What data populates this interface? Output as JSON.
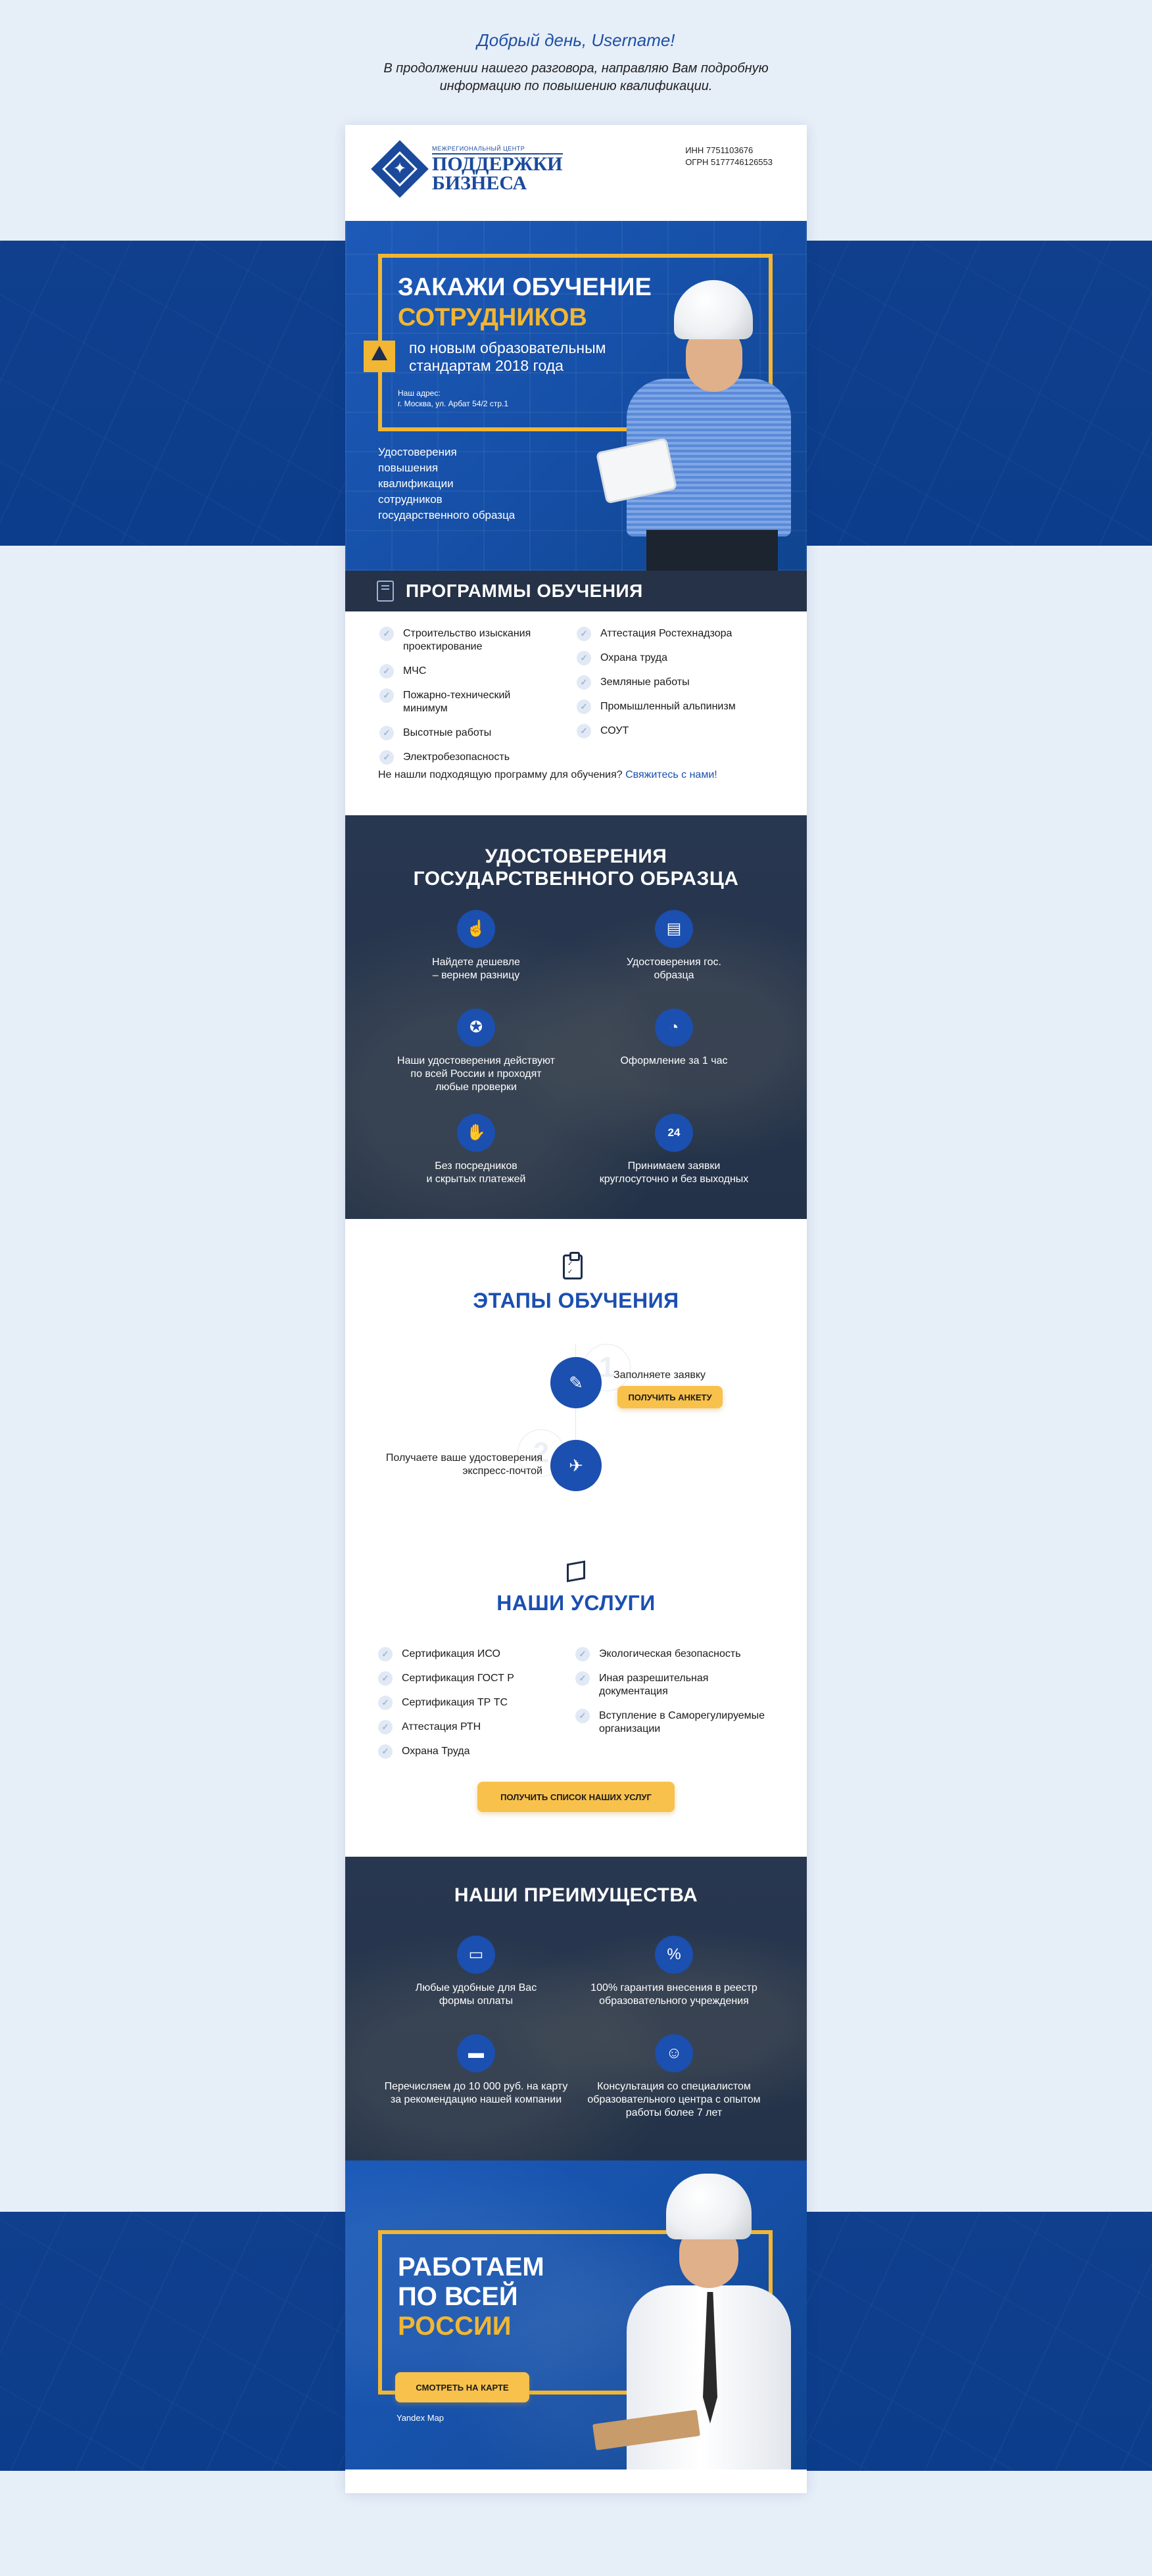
{
  "greeting": {
    "title": "Добрый день, Username!",
    "line1": "В продолжении нашего разговора, направляю Вам подробную",
    "line2": "информацию по повышению квалификации."
  },
  "header": {
    "logo_small": "МЕЖРЕГИОНАЛЬНЫЙ ЦЕНТР",
    "logo_line1": "ПОДДЕРЖКИ",
    "logo_line2": "БИЗНЕСА",
    "inn": "ИНН 7751103676",
    "ogrn": "ОГРН 5177746126553"
  },
  "hero": {
    "title_line1": "ЗАКАЖИ ОБУЧЕНИЕ",
    "title_line2": "СОТРУДНИКОВ",
    "sub_line1": "по новым образовательным",
    "sub_line2": "стандартам 2018 года",
    "addr_label": "Наш адрес:",
    "addr_value": "г. Москва, ул. Арбат 54/2 стр.1",
    "list": [
      "Удостоверения",
      "повышения",
      "квалификации",
      "сотрудников",
      "государственного образца"
    ]
  },
  "programs": {
    "title": "ПРОГРАММЫ ОБУЧЕНИЯ",
    "left": [
      "Строительство изыскания проектирование",
      "МЧС",
      "Пожарно-технический минимум",
      "Высотные работы",
      "Электробезопасность"
    ],
    "right": [
      "Аттестация Ростехнадзора",
      "Охрана труда",
      "Земляные работы",
      "Промышленный альпинизм",
      "СОУТ"
    ],
    "note": "Не нашли подходящую программу для обучения?",
    "note_link": "Свяжитесь с нами!"
  },
  "certificates": {
    "title_line1": "УДОСТОВЕРЕНИЯ",
    "title_line2": "ГОСУДАРСТВЕННОГО ОБРАЗЦА",
    "items": [
      {
        "l1": "Найдете дешевле",
        "l2": "– вернем разницу",
        "l3": ""
      },
      {
        "l1": "Удостоверения гос.",
        "l2": "образца",
        "l3": ""
      },
      {
        "l1": "Наши удостоверения действуют",
        "l2": "по всей России и проходят",
        "l3": "любые проверки"
      },
      {
        "l1": "Оформление за 1 час",
        "l2": "",
        "l3": ""
      },
      {
        "l1": "Без посредников",
        "l2": "и скрытых платежей",
        "l3": ""
      },
      {
        "l1": "Принимаем заявки",
        "l2": "круглосуточно и без выходных",
        "l3": ""
      }
    ]
  },
  "stages": {
    "title": "ЭТАПЫ ОБУЧЕНИЯ",
    "step1_num": "1",
    "step1_text": "Заполняете заявку",
    "step1_button": "ПОЛУЧИТЬ АНКЕТУ",
    "step2_num": "2",
    "step2_line1": "Получаете ваше удостоверения",
    "step2_line2": "экспресс-почтой"
  },
  "services": {
    "title": "НАШИ УСЛУГИ",
    "left": [
      "Сертификация ИСО",
      "Сертификация ГОСТ Р",
      "Сертификация ТР ТС",
      "Аттестация РТН",
      "Охрана Труда"
    ],
    "right": [
      "Экологическая безопасность",
      "Иная разрешительная документация",
      "Вступление в Саморегулируемые организации"
    ],
    "button": "ПОЛУЧИТЬ СПИСОК НАШИХ УСЛУГ"
  },
  "advantages": {
    "title": "НАШИ ПРЕИМУЩЕСТВА",
    "items": [
      {
        "l1": "Любые удобные для Вас",
        "l2": "формы оплаты",
        "l3": ""
      },
      {
        "l1": "100% гарантия внесения в реестр",
        "l2": "образовательного учреждения",
        "l3": ""
      },
      {
        "l1": "Перечисляем до 10 000 руб. на карту",
        "l2": "за рекомендацию нашей компании",
        "l3": ""
      },
      {
        "l1": "Консультация со специалистом",
        "l2": "образовательного центра с опытом",
        "l3": "работы более 7 лет"
      }
    ]
  },
  "russia": {
    "line1": "РАБОТАЕМ",
    "line2": "ПО ВСЕЙ",
    "line3": "РОССИИ",
    "button": "СМОТРЕТЬ НА КАРТЕ",
    "map_label": "Yandex Map"
  },
  "colors": {
    "brand_blue": "#1b4fb0",
    "accent_yellow": "#f2b632",
    "dark_panel": "#253247"
  }
}
